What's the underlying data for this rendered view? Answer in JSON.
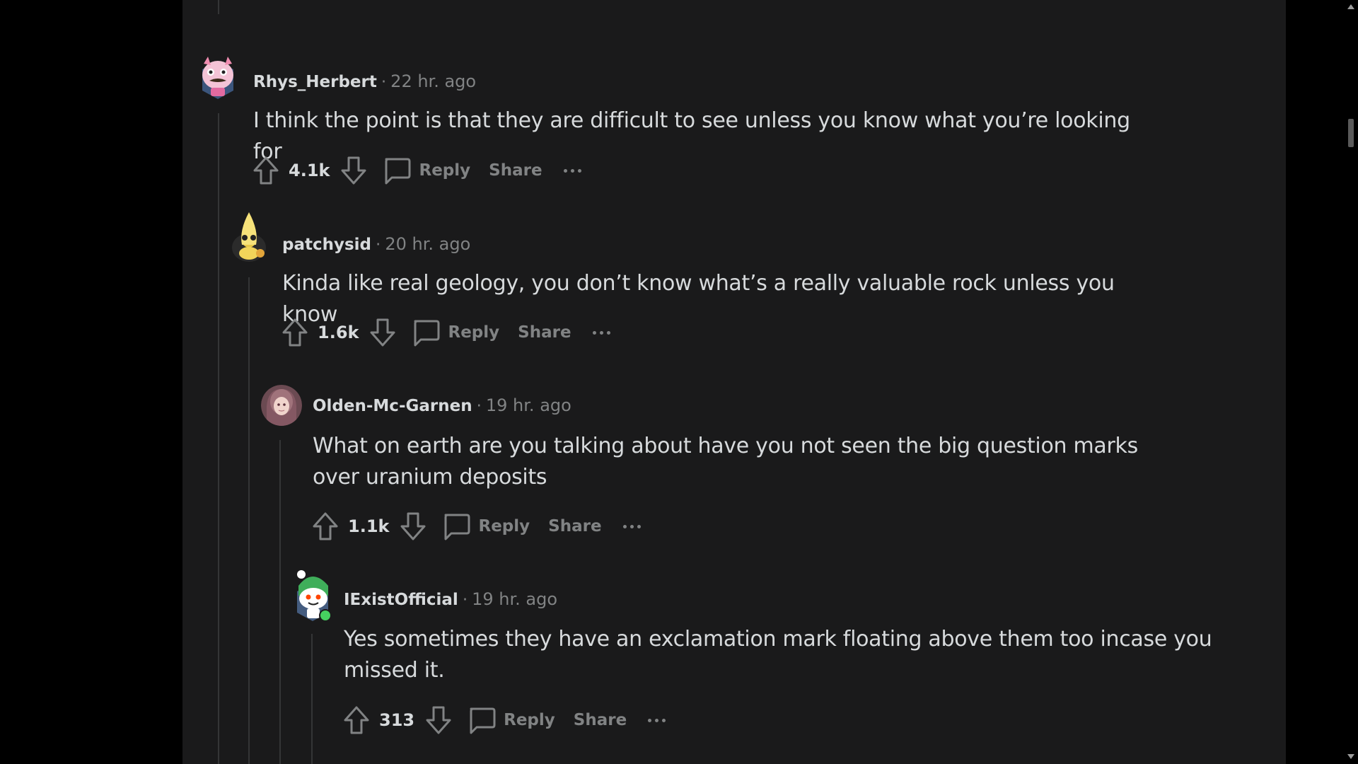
{
  "comments": [
    {
      "username": "Rhys_Herbert",
      "separator": "·",
      "time": "22 hr. ago",
      "body": "I think the point is that they are difficult to see unless you know what you’re looking for",
      "score": "4.1k",
      "reply_label": "Reply",
      "share_label": "Share"
    },
    {
      "username": "patchysid",
      "separator": "·",
      "time": "20 hr. ago",
      "body": "Kinda like real geology, you don’t know what’s a really valuable rock unless you know",
      "score": "1.6k",
      "reply_label": "Reply",
      "share_label": "Share"
    },
    {
      "username": "Olden-Mc-Garnen",
      "separator": "·",
      "time": "19 hr. ago",
      "body": "What on earth are you talking about have you not seen the big question marks over uranium deposits",
      "score": "1.1k",
      "reply_label": "Reply",
      "share_label": "Share"
    },
    {
      "username": "IExistOfficial",
      "separator": "·",
      "time": "19 hr. ago",
      "body": "Yes sometimes they have an exclamation mark floating above them too incase you missed it.",
      "score": "313",
      "reply_label": "Reply",
      "share_label": "Share"
    }
  ],
  "icons": {
    "upvote": "upvote-arrow-icon",
    "downvote": "downvote-arrow-icon",
    "comment": "comment-bubble-icon",
    "more": "more-options-icon"
  },
  "colors": {
    "background": "#1a1a1b",
    "text": "#d7dadc",
    "muted": "#818384",
    "thread_line": "#343536",
    "online": "#46d160"
  }
}
